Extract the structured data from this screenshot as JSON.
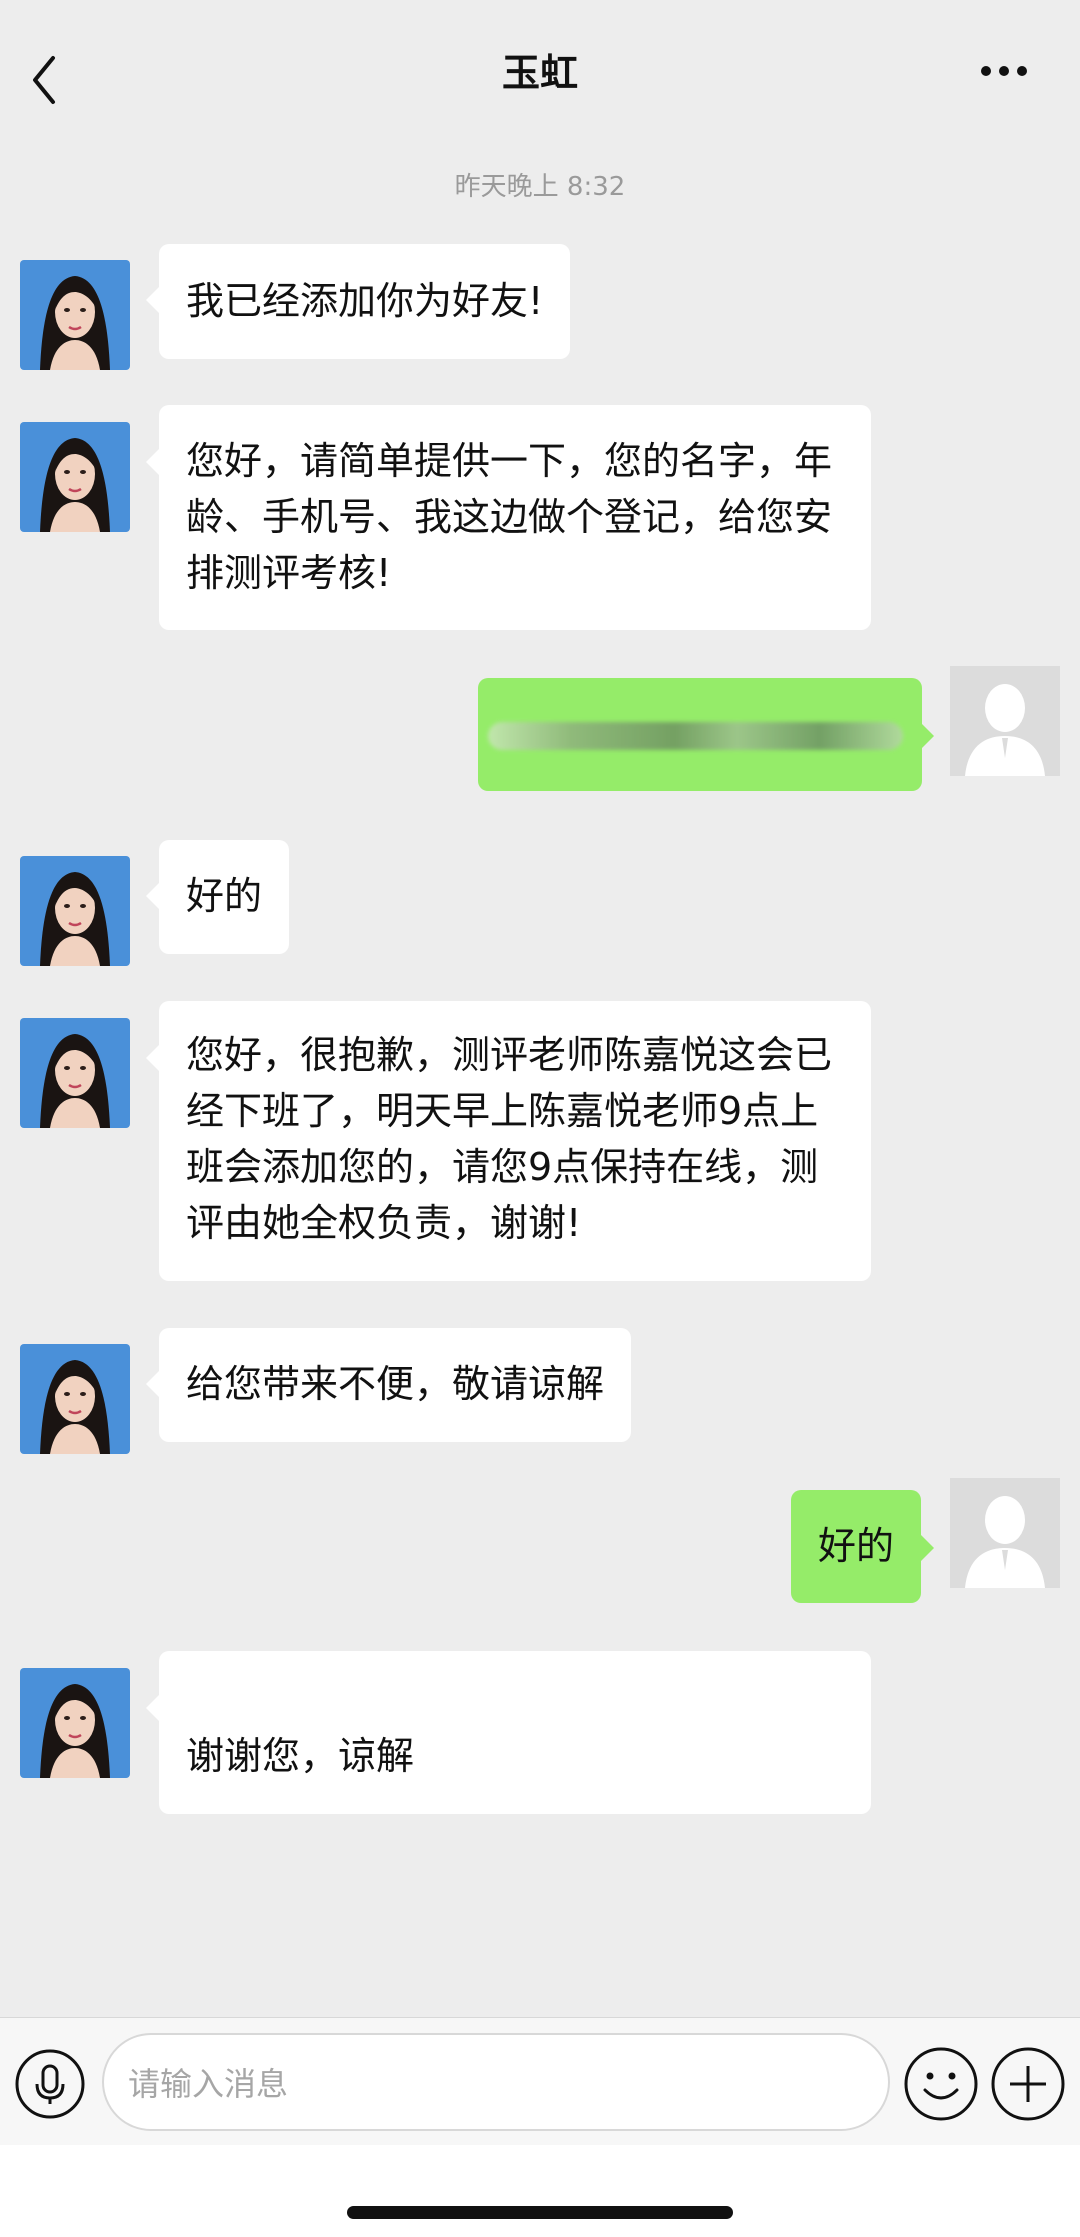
{
  "header": {
    "title": "玉虹",
    "back_icon": "chevron-left-icon",
    "more_icon": "more-horizontal-icon"
  },
  "timestamp": "昨天晚上 8:32",
  "messages": [
    {
      "side": "left",
      "text": "我已经添加你为好友!"
    },
    {
      "side": "left",
      "text": "您好，请简单提供一下，您的名字，年\n龄、手机号、我这边做个登记，给您安\n排测评考核!"
    },
    {
      "side": "right",
      "text": "",
      "blurred": true
    },
    {
      "side": "left",
      "text": "好的"
    },
    {
      "side": "left",
      "text": "您好，很抱歉，测评老师陈嘉悦这会已\n经下班了，明天早上陈嘉悦老师9点上\n班会添加您的，请您9点保持在线，测\n评由她全权负责，谢谢!"
    },
    {
      "side": "left",
      "text": "给您带来不便，敬请谅解"
    },
    {
      "side": "right",
      "text": "好的"
    },
    {
      "side": "left",
      "text": "谢谢您，谅解"
    }
  ],
  "input": {
    "placeholder": "请输入消息",
    "voice_icon": "microphone-icon",
    "emoji_icon": "emoji-smile-icon",
    "plus_icon": "plus-circle-icon"
  },
  "colors": {
    "background": "#ededed",
    "my_bubble": "#95ec69",
    "their_bubble": "#ffffff"
  }
}
